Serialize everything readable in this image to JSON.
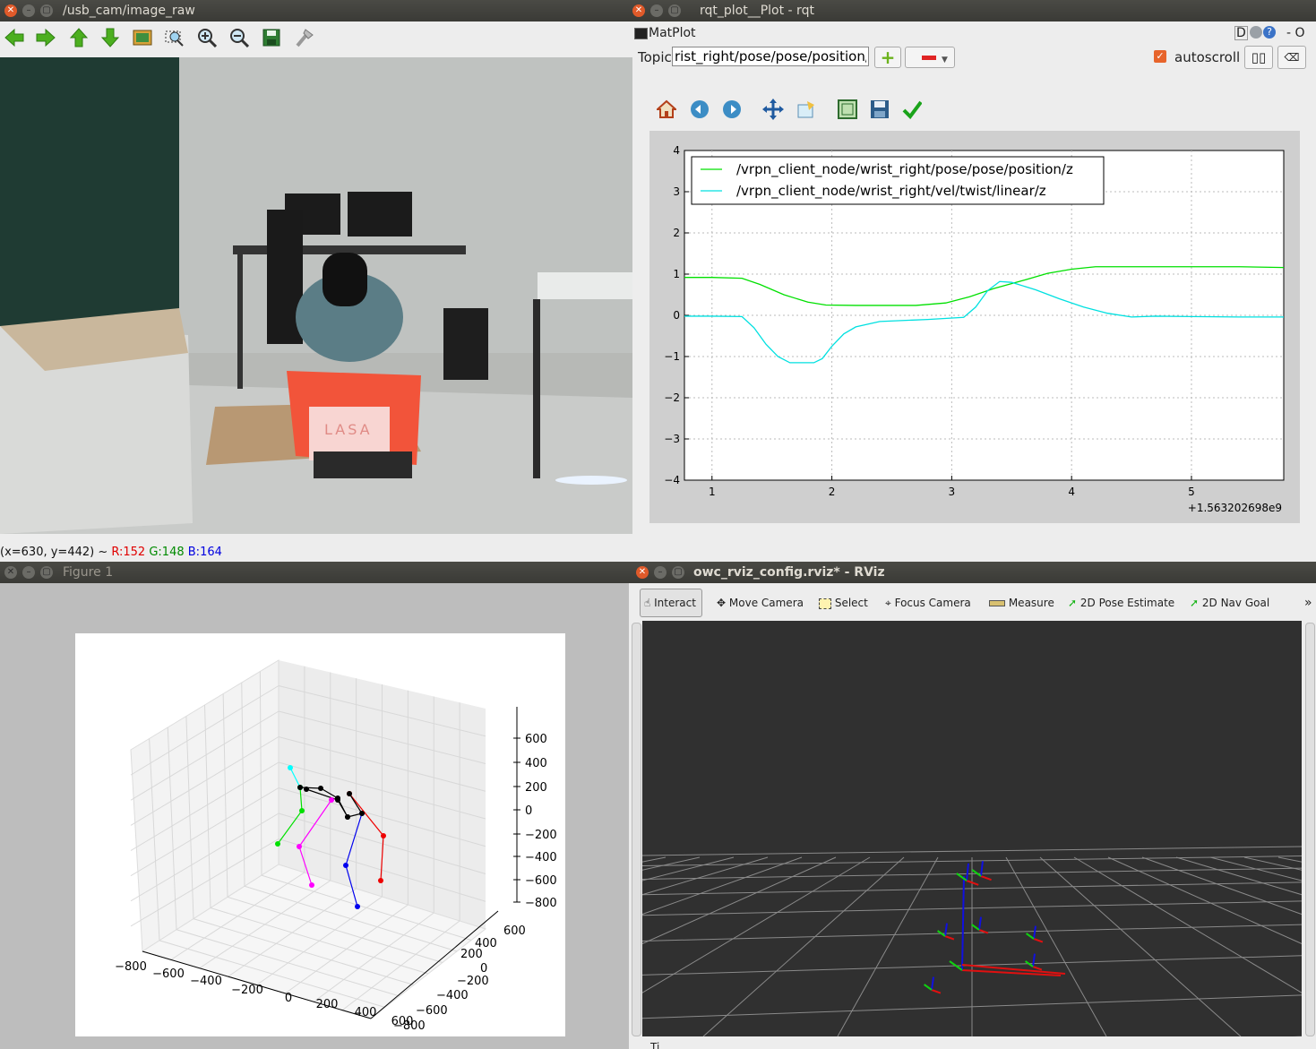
{
  "camera_window": {
    "title": "/usb_cam/image_raw",
    "toolbar_icons": [
      "back-arrow-icon",
      "forward-arrow-icon",
      "up-arrow-icon",
      "down-arrow-icon",
      "image-icon",
      "zoom-region-icon",
      "zoom-in-icon",
      "zoom-out-icon",
      "save-icon",
      "brush-icon"
    ],
    "status": {
      "coords": "(x=630, y=442) ~",
      "r": "R:152",
      "g": "G:148",
      "b": "B:164"
    },
    "scene_text": "LASA"
  },
  "rqt_window": {
    "title": "rqt_plot__Plot - rqt",
    "plugin_label": "MatPlot",
    "header_right": "D",
    "header_extra": "- O",
    "topic_label": "Topic",
    "topic_value": "rist_right/pose/pose/position/z",
    "autoscroll_label": "autoscroll",
    "toolbar_icons": [
      "home-icon",
      "back-icon",
      "forward-icon",
      "pan-icon",
      "configure-icon",
      "zoom-to-rect-icon",
      "save-icon",
      "check-icon"
    ],
    "colors": {
      "series1": "#00e000",
      "series2": "#00e0e0"
    }
  },
  "figure_window": {
    "title": "Figure 1"
  },
  "rviz_window": {
    "title": "owc_rviz_config.rviz* - RViz",
    "tools": [
      {
        "label": "Interact",
        "icon": "hand-icon"
      },
      {
        "label": "Move Camera",
        "icon": "move-camera-icon"
      },
      {
        "label": "Select",
        "icon": "select-icon"
      },
      {
        "label": "Focus Camera",
        "icon": "focus-camera-icon"
      },
      {
        "label": "Measure",
        "icon": "measure-icon"
      },
      {
        "label": "2D Pose Estimate",
        "icon": "pose-arrow-icon"
      },
      {
        "label": "2D Nav Goal",
        "icon": "nav-arrow-icon"
      }
    ],
    "overflow": "»",
    "bottom_text": "Ti"
  },
  "chart_data": [
    {
      "type": "line",
      "title": "",
      "xlabel": "",
      "ylabel": "",
      "x_offset_label": "+1.563202698e9",
      "xlim": [
        0.77,
        5.77
      ],
      "ylim": [
        -4,
        4
      ],
      "xticks": [
        "1",
        "2",
        "3",
        "4",
        "5"
      ],
      "yticks": [
        "4",
        "3",
        "2",
        "1",
        "0",
        "−1",
        "−2",
        "−3",
        "−4"
      ],
      "grid": true,
      "legend_position": "upper-left",
      "series": [
        {
          "name": "/vrpn_client_node/wrist_right/pose/pose/position/z",
          "color": "#00e000",
          "x": [
            0.77,
            1.0,
            1.25,
            1.4,
            1.6,
            1.8,
            1.95,
            2.2,
            2.7,
            2.95,
            3.15,
            3.35,
            3.6,
            3.8,
            4.0,
            4.2,
            4.6,
            5.0,
            5.4,
            5.77
          ],
          "y": [
            0.92,
            0.92,
            0.9,
            0.75,
            0.5,
            0.32,
            0.25,
            0.24,
            0.24,
            0.3,
            0.45,
            0.65,
            0.85,
            1.02,
            1.12,
            1.18,
            1.18,
            1.18,
            1.18,
            1.16
          ]
        },
        {
          "name": "/vrpn_client_node/wrist_right/vel/twist/linear/z",
          "color": "#00e0e0",
          "x": [
            0.77,
            1.0,
            1.25,
            1.35,
            1.45,
            1.55,
            1.65,
            1.75,
            1.85,
            1.92,
            2.0,
            2.1,
            2.2,
            2.4,
            2.8,
            3.1,
            3.2,
            3.3,
            3.4,
            3.5,
            3.7,
            3.9,
            4.1,
            4.3,
            4.5,
            4.7,
            5.0,
            5.4,
            5.77
          ],
          "y": [
            -0.02,
            -0.02,
            -0.03,
            -0.3,
            -0.7,
            -1.0,
            -1.15,
            -1.15,
            -1.15,
            -1.05,
            -0.75,
            -0.45,
            -0.28,
            -0.15,
            -0.1,
            -0.05,
            0.2,
            0.6,
            0.82,
            0.8,
            0.62,
            0.4,
            0.2,
            0.05,
            -0.04,
            -0.02,
            -0.03,
            -0.04,
            -0.04
          ]
        }
      ]
    },
    {
      "type": "scatter",
      "title": "",
      "xlabel": "",
      "ylabel": "",
      "xticks": [
        "−800",
        "−600",
        "−400",
        "−200",
        "0",
        "200",
        "400",
        "600"
      ],
      "yticks": [
        "−800",
        "−600",
        "−400",
        "−200",
        "0",
        "200",
        "400",
        "600"
      ],
      "zticks": [
        "600",
        "400",
        "200",
        "0",
        "−200",
        "−400",
        "−600",
        "−800"
      ],
      "grid": true,
      "series": [
        {
          "name": "",
          "color": "#00ffff"
        },
        {
          "name": "",
          "color": "#00e000"
        },
        {
          "name": "",
          "color": "#000000"
        },
        {
          "name": "",
          "color": "#ff00ff"
        },
        {
          "name": "",
          "color": "#0000ee"
        },
        {
          "name": "",
          "color": "#ee0000"
        }
      ]
    }
  ]
}
